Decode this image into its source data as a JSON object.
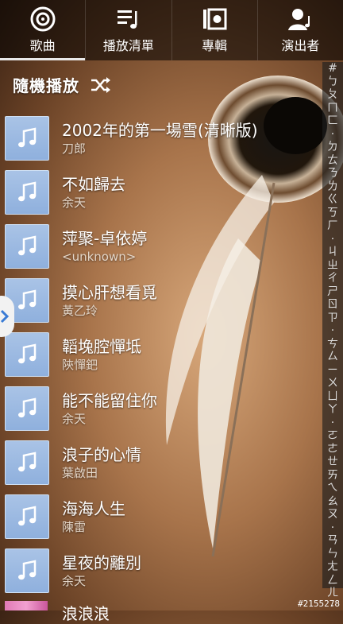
{
  "tabs": [
    {
      "label": "歌曲",
      "icon": "disc-icon",
      "active": true
    },
    {
      "label": "播放清單",
      "icon": "playlist-icon",
      "active": false
    },
    {
      "label": "專輯",
      "icon": "album-icon",
      "active": false
    },
    {
      "label": "演出者",
      "icon": "artist-icon",
      "active": false
    }
  ],
  "shuffle": {
    "label": "隨機播放",
    "icon": "shuffle-icon"
  },
  "songs": [
    {
      "title": "2002年的第一場雪(清晰版)",
      "artist": "刀郎"
    },
    {
      "title": "不如歸去",
      "artist": "余天"
    },
    {
      "title": "萍聚-卓依婷",
      "artist": "<unknown>"
    },
    {
      "title": "摸心肝想看覓",
      "artist": "黃乙玲"
    },
    {
      "title": "韜堍腔憚坻",
      "artist": "陝憚鈀"
    },
    {
      "title": "能不能留住你",
      "artist": "余天"
    },
    {
      "title": "浪子的心情",
      "artist": "葉啟田"
    },
    {
      "title": "海海人生",
      "artist": "陳雷"
    },
    {
      "title": "星夜的離別",
      "artist": "余天"
    }
  ],
  "partial_song": {
    "title": "浪浪浪"
  },
  "index": [
    "#",
    "ㄅ",
    "ㄆ",
    "ㄇ",
    "ㄈ",
    "·",
    "ㄉ",
    "ㄊ",
    "ㄋ",
    "ㄌ",
    "ㄍ",
    "ㄎ",
    "ㄏ",
    "·",
    "ㄐ",
    "ㄓ",
    "ㄔ",
    "ㄕ",
    "ㄖ",
    "ㄗ",
    "·",
    "ㄘ",
    "ㄙ",
    "ㄧ",
    "ㄨ",
    "ㄩ",
    "ㄚ",
    "·",
    "ㄛ",
    "ㄜ",
    "ㄝ",
    "ㄞ",
    "ㄟ",
    "ㄠ",
    "ㄡ",
    "·",
    "ㄢ",
    "ㄣ",
    "ㄤ",
    "ㄥ",
    "ㄦ",
    "·"
  ],
  "watermark": "#2155278",
  "colors": {
    "tab_bg": "#000000",
    "thumb": "#9fbbe2",
    "index_bg": "#1e1e1e"
  }
}
